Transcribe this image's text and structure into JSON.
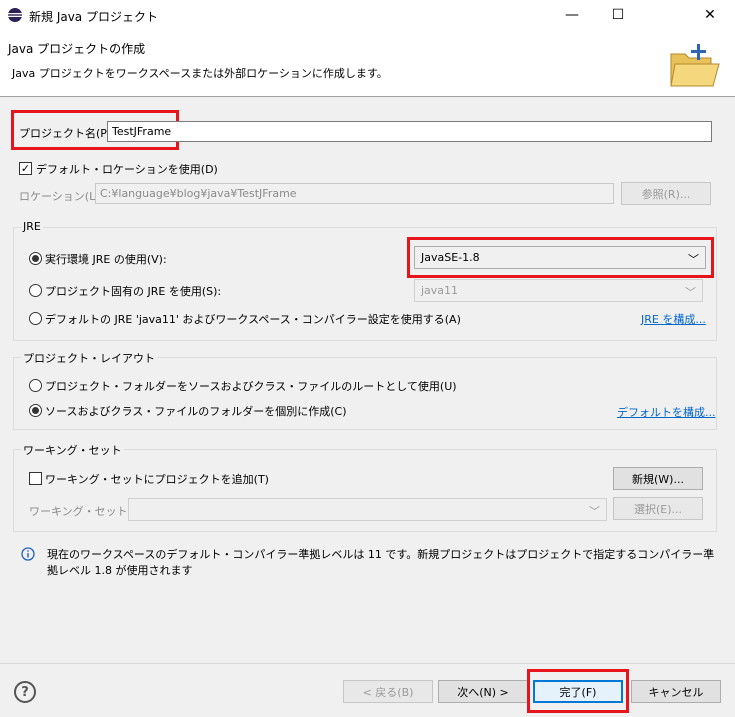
{
  "window": {
    "title": "新規 Java プロジェクト",
    "minimize": "—",
    "maximize": "☐",
    "close": "✕"
  },
  "header": {
    "title": "Java プロジェクトの作成",
    "description": "Java プロジェクトをワークスペースまたは外部ロケーションに作成します。"
  },
  "project": {
    "name_label": "プロジェクト名(P):",
    "name_value": "TestJFrame",
    "default_location_label": "デフォルト・ロケーションを使用(D)",
    "default_location_checked": true,
    "location_label": "ロケーション(L):",
    "location_value": "C:¥language¥blog¥java¥TestJFrame",
    "browse_label": "参照(R)..."
  },
  "jre": {
    "group_title": "JRE",
    "options": [
      "実行環境 JRE の使用(V):",
      "プロジェクト固有の JRE を使用(S):",
      "デフォルトの JRE 'java11' およびワークスペース・コンパイラー設定を使用する(A)"
    ],
    "selected_index": 0,
    "env_value": "JavaSE-1.8",
    "specific_value": "java11",
    "configure_link": "JRE を構成..."
  },
  "layout": {
    "group_title": "プロジェクト・レイアウト",
    "options": [
      "プロジェクト・フォルダーをソースおよびクラス・ファイルのルートとして使用(U)",
      "ソースおよびクラス・ファイルのフォルダーを個別に作成(C)"
    ],
    "selected_index": 1,
    "configure_link": "デフォルトを構成..."
  },
  "working_set": {
    "group_title": "ワーキング・セット",
    "add_label": "ワーキング・セットにプロジェクトを追加(T)",
    "add_checked": false,
    "new_button": "新規(W)...",
    "sets_label": "ワーキング・セット(O):",
    "sets_value": "",
    "select_button": "選択(E)..."
  },
  "info": {
    "message": "現在のワークスペースのデフォルト・コンパイラー準拠レベルは 11 です。新規プロジェクトはプロジェクトで指定するコンパイラー準拠レベル 1.8 が使用されます"
  },
  "footer": {
    "help_icon": "?",
    "back": "< 戻る(B)",
    "next": "次へ(N) >",
    "finish": "完了(F)",
    "cancel": "キャンセル"
  },
  "colors": {
    "highlight_red": "#e8141b",
    "link_blue": "#0066cc",
    "primary_blue": "#0078d7"
  }
}
